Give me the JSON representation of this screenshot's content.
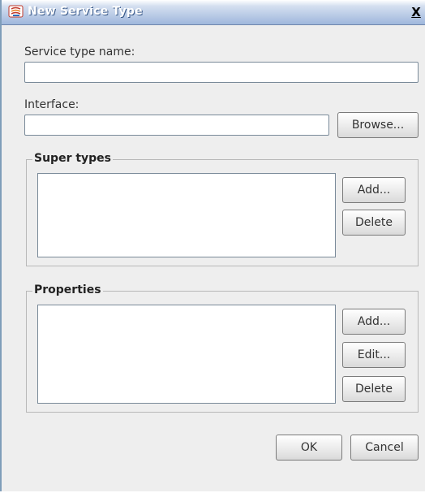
{
  "window": {
    "title": "New Service Type",
    "close_label": "X"
  },
  "form": {
    "service_type_name_label": "Service type name:",
    "service_type_name_value": "",
    "interface_label": "Interface:",
    "interface_value": "",
    "browse_label": "Browse..."
  },
  "super_types": {
    "title": "Super types",
    "add_label": "Add...",
    "delete_label": "Delete",
    "items": []
  },
  "properties": {
    "title": "Properties",
    "add_label": "Add...",
    "edit_label": "Edit...",
    "delete_label": "Delete",
    "items": []
  },
  "footer": {
    "ok_label": "OK",
    "cancel_label": "Cancel"
  }
}
